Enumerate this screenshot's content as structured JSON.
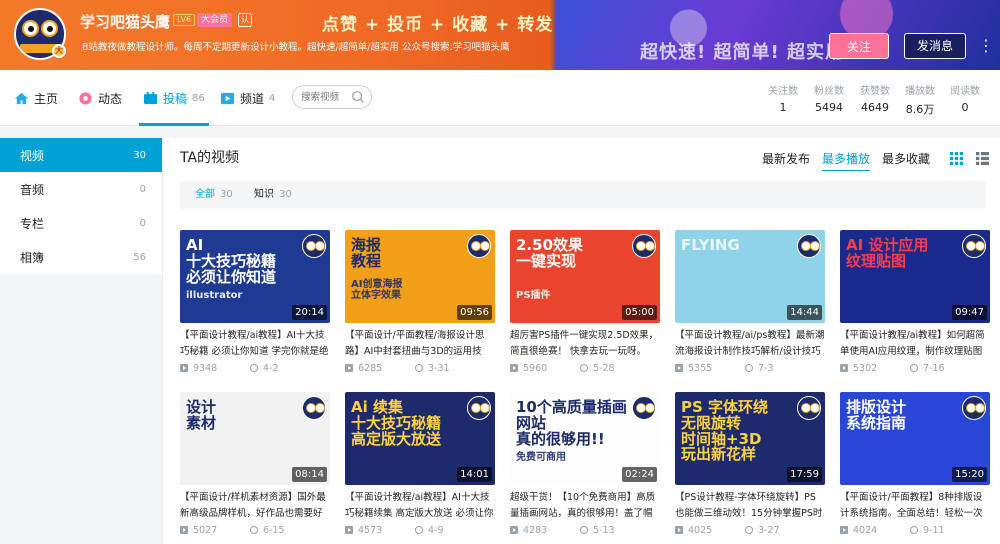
{
  "banner": {
    "slogan": "点赞 + 投币 + 收藏 + 转发",
    "slogan2": "超快速! 超简单! 超实用",
    "username": "学习吧猫头鹰",
    "level": "LV6",
    "vip_label": "大会员",
    "verify_label": "认",
    "signature": "B站教夜做教程设计师。每周不定期更新设计小教程。超快速/超简单/超实用 公众号搜索:学习吧猫头鹰",
    "follow_label": "关注",
    "message_label": "发消息",
    "more_label": "⋮"
  },
  "nav": {
    "items": [
      {
        "label": "主页",
        "count": ""
      },
      {
        "label": "动态",
        "count": ""
      },
      {
        "label": "投稿",
        "count": "86"
      },
      {
        "label": "频道",
        "count": "4"
      }
    ],
    "search_placeholder": "搜索视频",
    "stats": [
      {
        "label": "关注数",
        "value": "1"
      },
      {
        "label": "粉丝数",
        "value": "5494"
      },
      {
        "label": "获赞数",
        "value": "4649"
      },
      {
        "label": "播放数",
        "value": "8.6万"
      },
      {
        "label": "阅读数",
        "value": "0"
      }
    ]
  },
  "sidebar": {
    "items": [
      {
        "label": "视频",
        "count": "30"
      },
      {
        "label": "音频",
        "count": "0"
      },
      {
        "label": "专栏",
        "count": "0"
      },
      {
        "label": "相簿",
        "count": "56"
      }
    ]
  },
  "main": {
    "title": "TA的视频",
    "sort": [
      "最新发布",
      "最多播放",
      "最多收藏"
    ],
    "filters": [
      {
        "label": "全部",
        "count": "30"
      },
      {
        "label": "知识",
        "count": "30"
      }
    ]
  },
  "videos": [
    {
      "thumb_text": "AI\n十大技巧秘籍\n必须让你知道",
      "thumb_sub": "illustrator",
      "duration": "20:14",
      "title": "【平面设计教程/ai教程】AI十大技巧秘籍 必须让你知道 学完你就是绝",
      "plays": "9348",
      "date": "4-2",
      "bg": "#1f3a93",
      "fg": "#ffffff"
    },
    {
      "thumb_text": "海报\n教程",
      "thumb_sub": "AI创意海报\n立体字效果",
      "duration": "09:56",
      "title": "【平面设计/平面教程/海报设计思路】AI中封套扭曲与3D的运用技",
      "plays": "6285",
      "date": "3-31",
      "bg": "#f29f1a",
      "fg": "#1d2a6b"
    },
    {
      "thumb_text": "2.50效果\n一键实现",
      "thumb_sub": "PS插件",
      "duration": "05:00",
      "title": "超厉害PS插件一键实现2.5D效果，简直很绝赛！ 快拿去玩一玩呀。",
      "plays": "5960",
      "date": "5-28",
      "bg": "#e8442e",
      "fg": "#ffffff"
    },
    {
      "thumb_text": "FLYING",
      "thumb_sub": "",
      "duration": "14:44",
      "title": "【平面设计教程/ai/ps教程】最新潮流海报设计制作技巧解析/设计技巧",
      "plays": "5355",
      "date": "7-3",
      "bg": "#8fd3e8",
      "fg": "#e9f7ff"
    },
    {
      "thumb_text": "AI 设计应用\n纹理贴图",
      "thumb_sub": "",
      "duration": "09:47",
      "title": "【平面设计教程/ai教程】如何超简单使用AI应用纹理，制作纹理贴图",
      "plays": "5302",
      "date": "7-16",
      "bg": "#1a2a8c",
      "fg": "#ff3b4e"
    },
    {
      "thumb_text": "设计\n素材",
      "thumb_sub": "",
      "duration": "08:14",
      "title": "【平面设计/样机素材资源】国外最新高级品牌样机，好作品也需要好",
      "plays": "5027",
      "date": "6-15",
      "bg": "#f2f2f2",
      "fg": "#1d2a6b"
    },
    {
      "thumb_text": "Ai 续集\n十大技巧秘籍\n高定版大放送",
      "thumb_sub": "",
      "duration": "14:01",
      "title": "【平面设计教程/ai教程】AI十大技巧秘籍续集 高定版大放送 必须让你",
      "plays": "4573",
      "date": "4-9",
      "bg": "#1d2a6b",
      "fg": "#ffd23f"
    },
    {
      "thumb_text": "10个高质量插画网站\n真的很够用!!",
      "thumb_sub": "免费可商用",
      "duration": "02:24",
      "title": "超级干货！【10个免费商用】高质量插画网站，真的很够用！盖了帽",
      "plays": "4283",
      "date": "5-13",
      "bg": "#fdfdfd",
      "fg": "#1d2a6b"
    },
    {
      "thumb_text": "PS 字体环绕\n无限旋转\n时间轴+3D\n玩出新花样",
      "thumb_sub": "",
      "duration": "17:59",
      "title": "【PS设计教程-字体环绕旋转】PS也能做三维动效！15分钟掌握PS时间",
      "plays": "4025",
      "date": "3-27",
      "bg": "#1d2a6b",
      "fg": "#ffd23f"
    },
    {
      "thumb_text": "排版设计\n系统指南",
      "thumb_sub": "",
      "duration": "15:20",
      "title": "【平面设计/平面教程】8种排版设计系统指南。全面总结！轻松一次",
      "plays": "4024",
      "date": "9-11",
      "bg": "#2a46d6",
      "fg": "#ffffff"
    }
  ],
  "colors": {
    "accent": "#00a1d6",
    "pink": "#fb7299",
    "muted": "#99a2aa"
  }
}
